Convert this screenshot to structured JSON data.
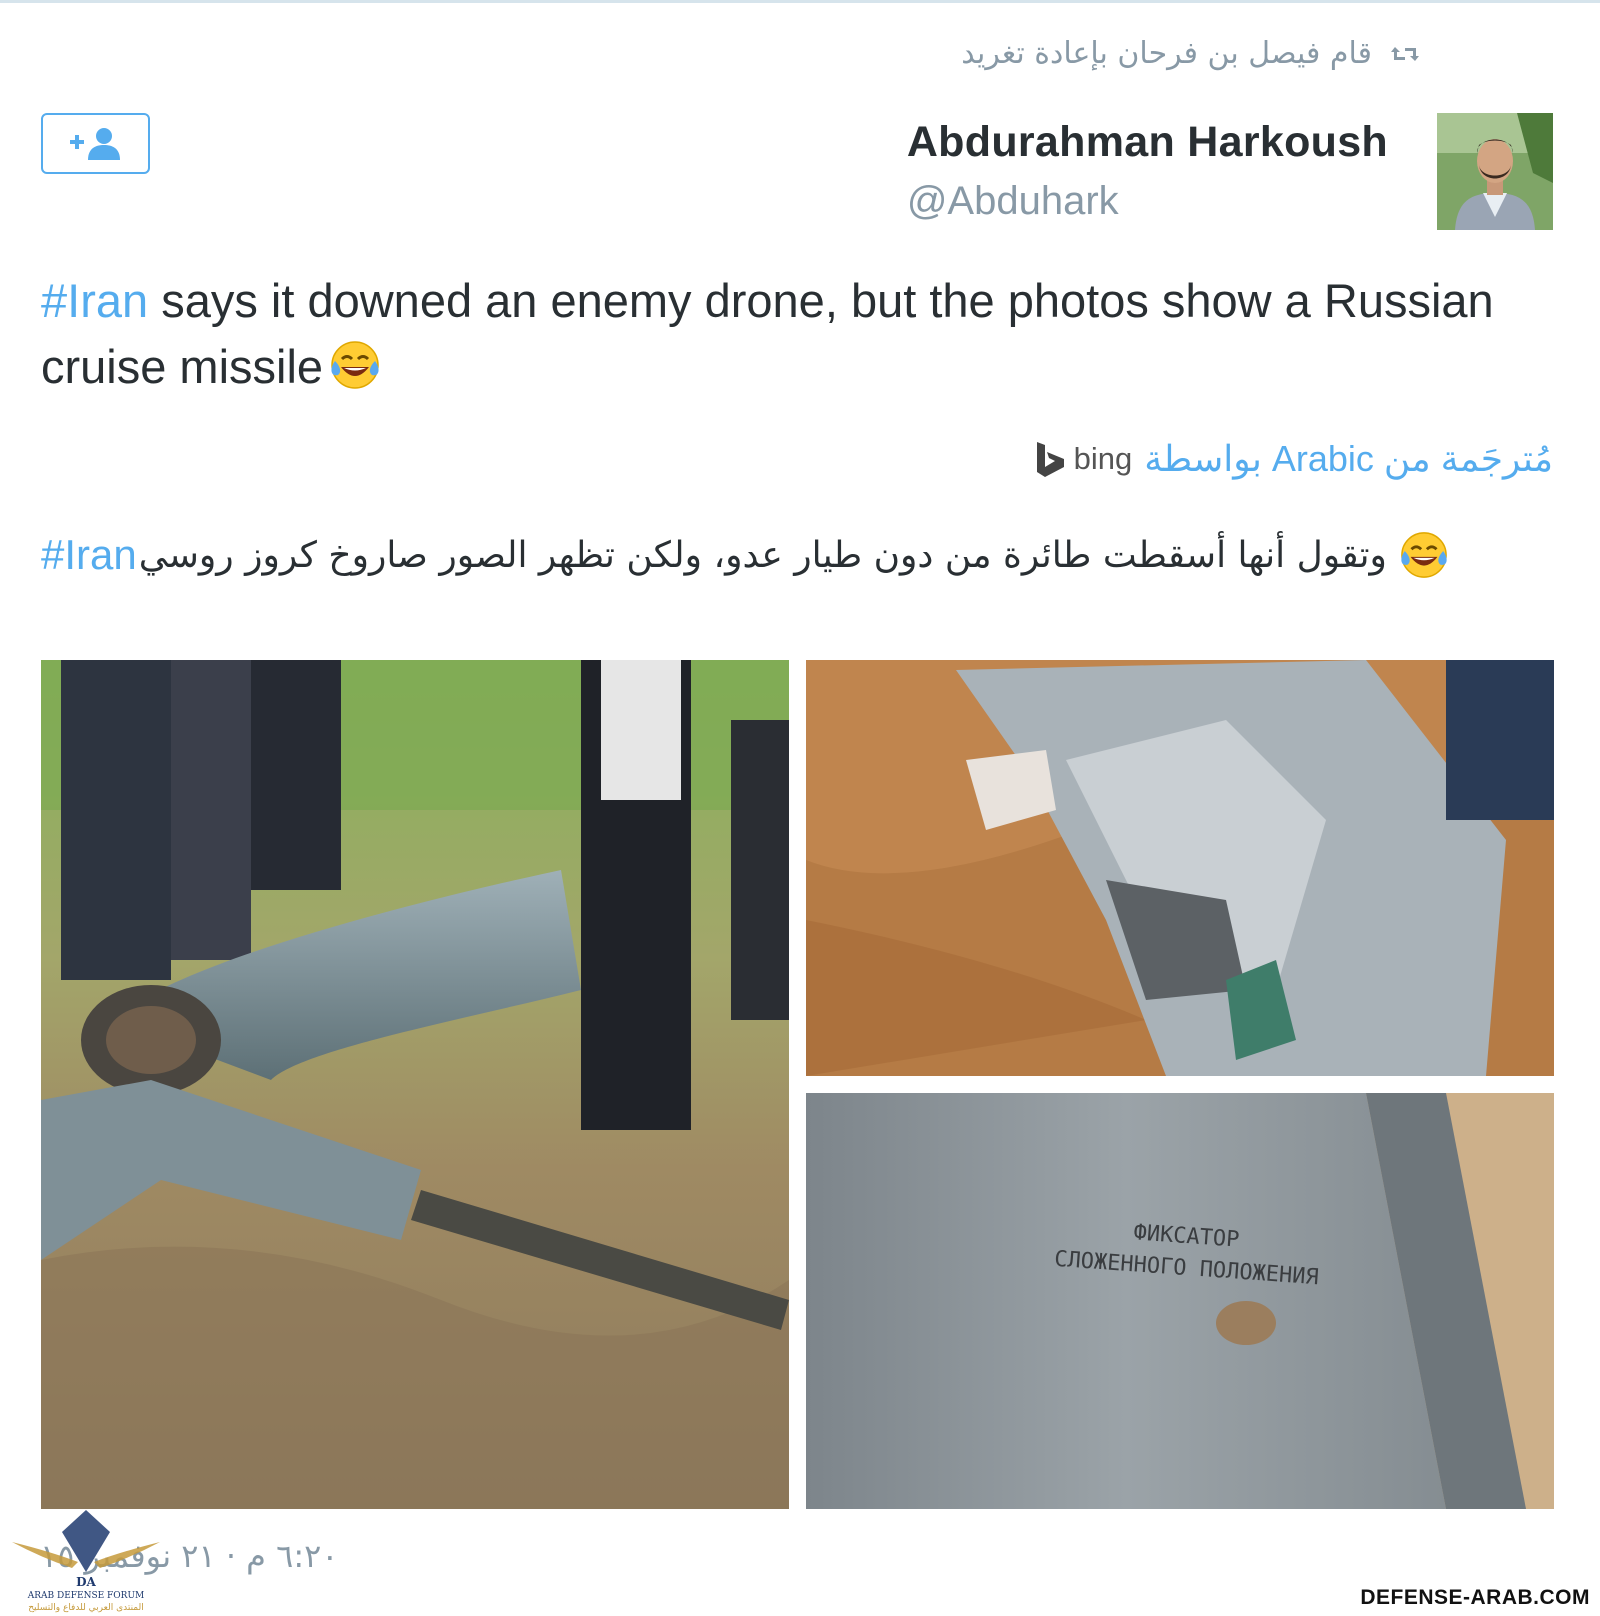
{
  "retweet": {
    "text": "قام فيصل بن فرحان بإعادة تغريد",
    "icon": "retweet-icon"
  },
  "follow_button": {
    "icon": "follow-user-icon",
    "color": "#55acee"
  },
  "author": {
    "name": "Abdurahman Harkoush",
    "handle": "@Abduhark"
  },
  "tweet": {
    "hashtag": "#Iran",
    "text": " says it downed an enemy drone, but the photos show a Russian cruise missile",
    "emoji": "tears-of-joy-emoji"
  },
  "translation_label": {
    "text": "مُترجَمة من Arabic بواسطة",
    "provider": "bing"
  },
  "translation": {
    "text": "وتقول أنها أسقطت طائرة من دون طيار عدو، ولكن تظهر الصور صاروخ كروز روسي",
    "hashtag": "#Iran"
  },
  "photos": {
    "stencil_line1": "ФИКСАТОР",
    "stencil_line2": "СЛОЖЕННОГО ПОЛОЖЕНИЯ"
  },
  "timestamp": "٦:٢٠ م · ٢١ نوفمبر ١٥",
  "watermark": {
    "logo_line1": "ARAB DEFENSE FORUM",
    "logo_line2": "المنتدى العربي للدفاع والتسليح",
    "logo_mark": "DA",
    "site": "DEFENSE-ARAB.COM"
  },
  "colors": {
    "accent": "#55acee",
    "muted": "#8899a6",
    "text": "#292f33"
  }
}
